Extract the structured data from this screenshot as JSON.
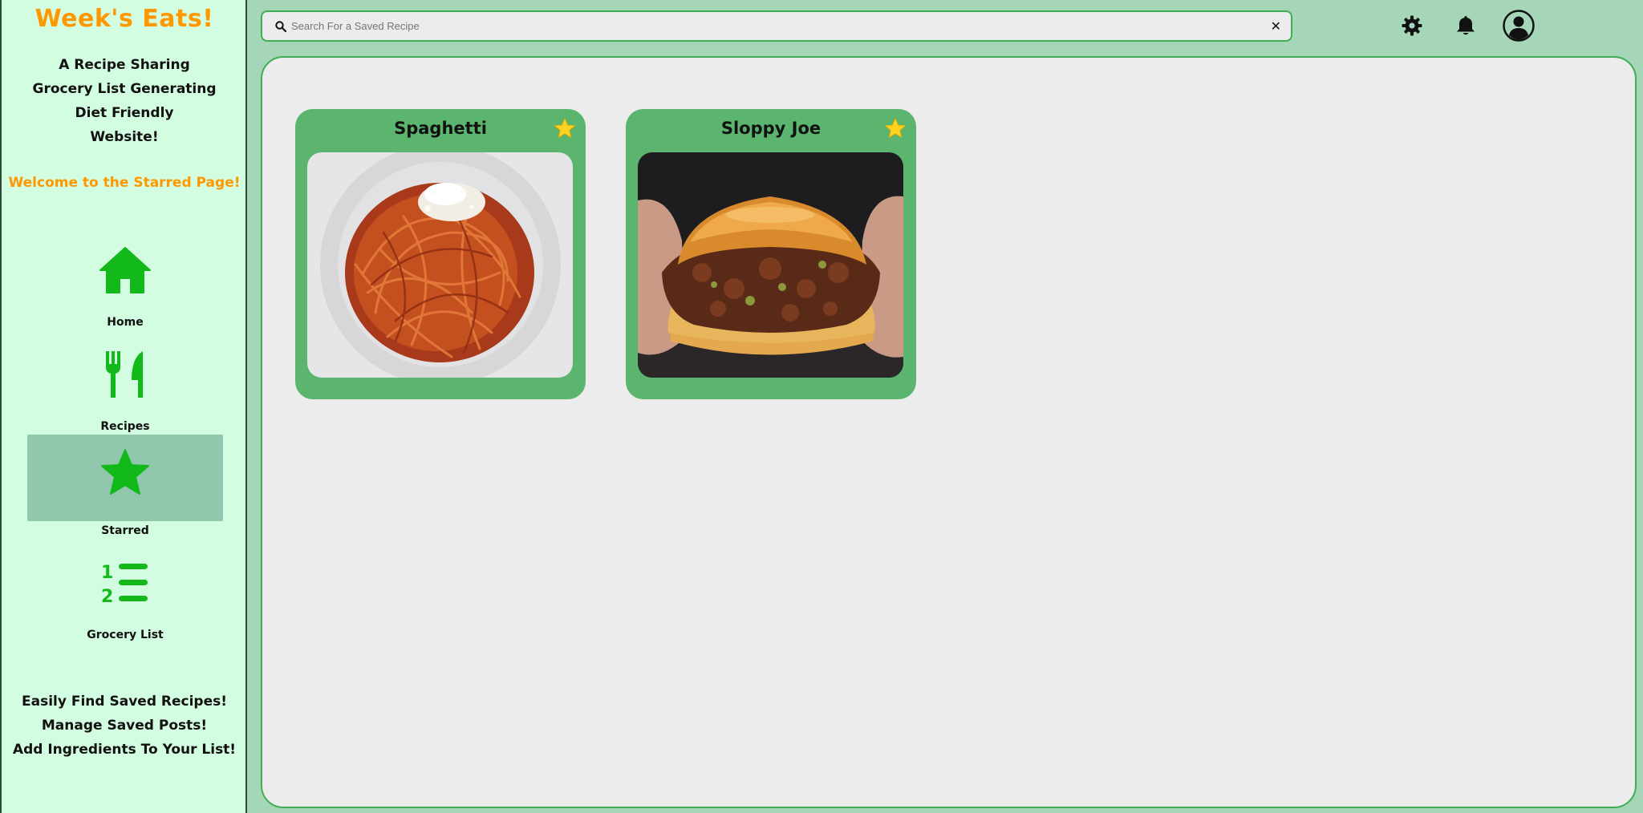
{
  "sidebar": {
    "brand": "Week's Eats!",
    "tagline": [
      "A Recipe Sharing",
      "Grocery List Generating",
      "Diet Friendly",
      "Website!"
    ],
    "welcome": "Welcome to the Starred Page!",
    "nav": [
      {
        "label": "Home",
        "icon": "home-icon"
      },
      {
        "label": "Recipes",
        "icon": "fork-knife-icon"
      },
      {
        "label": "Starred",
        "icon": "star-icon",
        "active": true
      },
      {
        "label": "Grocery List",
        "icon": "numbered-list-icon"
      }
    ],
    "features": [
      "Easily Find Saved Recipes!",
      "Manage Saved Posts!",
      "Add Ingredients To Your List!"
    ]
  },
  "header": {
    "search_placeholder": "Search For a Saved Recipe",
    "search_value": "",
    "clear_label": "✕",
    "icons": [
      "gear-icon",
      "bell-icon",
      "user-avatar-icon"
    ]
  },
  "main": {
    "cards": [
      {
        "title": "Spaghetti",
        "starred": true,
        "image": "spaghetti-image"
      },
      {
        "title": "Sloppy Joe",
        "starred": true,
        "image": "sloppy-joe-image"
      }
    ]
  },
  "colors": {
    "accent": "#ff9800",
    "nav_green": "#13b81a",
    "card_green": "#5bb56f",
    "star_yellow": "#ffd21f",
    "sidebar_bg": "#d3fde0",
    "page_bg": "#a5d6b7"
  }
}
